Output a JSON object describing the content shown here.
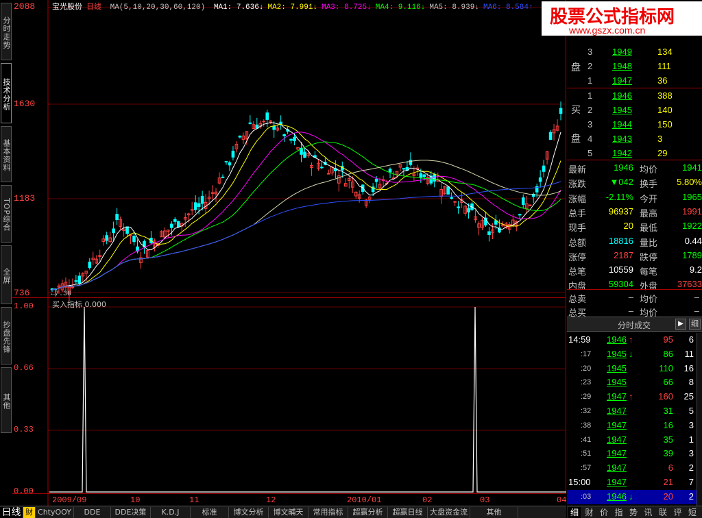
{
  "stock": {
    "name": "宝光股份",
    "period": "日线"
  },
  "ma_header": {
    "ma_params": "MA(5,10,20,30,60,120)",
    "items": [
      {
        "label": "MA1:",
        "value": "7.636↓",
        "color": "#ffffff"
      },
      {
        "label": "MA2:",
        "value": "7.991↓",
        "color": "#ffff00"
      },
      {
        "label": "MA3:",
        "value": "8.725↓",
        "color": "#ff00ff"
      },
      {
        "label": "MA4:",
        "value": "9.116↓",
        "color": "#00ff00"
      },
      {
        "label": "MA5:",
        "value": "8.939↓",
        "color": "#c0c0c0"
      },
      {
        "label": "MA6:",
        "value": "8.584↑",
        "color": "#3050ff"
      }
    ]
  },
  "left_tabs": [
    "分时走势",
    "技术分析",
    "基本资料",
    "TOP综合",
    "全屏",
    "抄盘先锋",
    "其他"
  ],
  "price_axis": [
    "2088",
    "1630",
    "1183",
    "736"
  ],
  "low_marker": "7.36",
  "indicator": {
    "name": "买入指标",
    "value": "0.000",
    "axis": [
      "1.00",
      "0.66",
      "0.33",
      "0.00"
    ]
  },
  "x_axis": [
    "2009/09",
    "10",
    "11",
    "12",
    "2010/01",
    "02",
    "03",
    "04"
  ],
  "bottom_tabs": [
    "日线",
    "财",
    "ChtyOOY",
    "DDE",
    "DDE决策",
    "K.D.J",
    "标准",
    "博文分析",
    "博文晡天",
    "常用指标",
    "超赢分析",
    "超赢日线",
    "大盘资金流",
    "其他"
  ],
  "watermark": {
    "title": "股票公式指标网",
    "url": "www.gszx.com.cn"
  },
  "order_book": {
    "sell": [
      {
        "level": "3",
        "price": "1949",
        "vol": "134"
      },
      {
        "level": "2",
        "price": "1948",
        "vol": "111"
      },
      {
        "level": "1",
        "price": "1947",
        "vol": "36"
      }
    ],
    "buy": [
      {
        "level": "1",
        "price": "1946",
        "vol": "388"
      },
      {
        "level": "2",
        "price": "1945",
        "vol": "140"
      },
      {
        "level": "3",
        "price": "1944",
        "vol": "150"
      },
      {
        "level": "4",
        "price": "1943",
        "vol": "3"
      },
      {
        "level": "5",
        "price": "1942",
        "vol": "29"
      }
    ],
    "sell_label": "盘",
    "buy_label_1": "买",
    "buy_label_2": "盘"
  },
  "quote": [
    {
      "l1": "最新",
      "v1": "1946",
      "c1": "#00ff00",
      "l2": "均价",
      "v2": "1941",
      "c2": "#00ff00"
    },
    {
      "l1": "涨跌",
      "v1": "▼042",
      "c1": "#00ff00",
      "l2": "换手",
      "v2": "5.80%",
      "c2": "#ffff00"
    },
    {
      "l1": "涨幅",
      "v1": "-2.11%",
      "c1": "#00ff00",
      "l2": "今开",
      "v2": "1965",
      "c2": "#00ff00"
    },
    {
      "l1": "总手",
      "v1": "96937",
      "c1": "#ffff00",
      "l2": "最高",
      "v2": "1991",
      "c2": "#ff4040"
    },
    {
      "l1": "现手",
      "v1": "20",
      "c1": "#ffff00",
      "l2": "最低",
      "v2": "1922",
      "c2": "#00ff00"
    },
    {
      "l1": "总额",
      "v1": "18816",
      "c1": "#00ffff",
      "l2": "量比",
      "v2": "0.44",
      "c2": "#ffffff"
    },
    {
      "l1": "涨停",
      "v1": "2187",
      "c1": "#ff4040",
      "l2": "跌停",
      "v2": "1789",
      "c2": "#00ff00"
    },
    {
      "l1": "总笔",
      "v1": "10559",
      "c1": "#ffffff",
      "l2": "每笔",
      "v2": "9.2",
      "c2": "#ffffff"
    },
    {
      "l1": "内盘",
      "v1": "59304",
      "c1": "#00ff00",
      "l2": "外盘",
      "v2": "37633",
      "c2": "#ff4040"
    }
  ],
  "totals": [
    {
      "l1": "总卖",
      "v1": "–",
      "l2": "均价",
      "v2": "–"
    },
    {
      "l1": "总买",
      "v1": "–",
      "l2": "均价",
      "v2": "–"
    }
  ],
  "ticks_title": "分时成交",
  "ticks_btn": "细",
  "ticks": [
    {
      "time": "14:59",
      "price": "1946",
      "arrow": "↑",
      "vol": "95",
      "vc": "#ff4040",
      "n": "6"
    },
    {
      "time": ":17",
      "price": "1945",
      "arrow": "↓",
      "vol": "86",
      "vc": "#00ff00",
      "n": "11"
    },
    {
      "time": ":20",
      "price": "1945",
      "arrow": "",
      "vol": "110",
      "vc": "#00ff00",
      "n": "16"
    },
    {
      "time": ":23",
      "price": "1945",
      "arrow": "",
      "vol": "66",
      "vc": "#00ff00",
      "n": "8"
    },
    {
      "time": ":29",
      "price": "1947",
      "arrow": "↑",
      "vol": "160",
      "vc": "#ff4040",
      "n": "25"
    },
    {
      "time": ":32",
      "price": "1947",
      "arrow": "",
      "vol": "31",
      "vc": "#00ff00",
      "n": "5"
    },
    {
      "time": ":38",
      "price": "1947",
      "arrow": "",
      "vol": "16",
      "vc": "#00ff00",
      "n": "3"
    },
    {
      "time": ":41",
      "price": "1947",
      "arrow": "",
      "vol": "35",
      "vc": "#00ff00",
      "n": "1"
    },
    {
      "time": ":51",
      "price": "1947",
      "arrow": "",
      "vol": "39",
      "vc": "#00ff00",
      "n": "3"
    },
    {
      "time": ":57",
      "price": "1947",
      "arrow": "",
      "vol": "6",
      "vc": "#ff4040",
      "n": "2"
    },
    {
      "time": "15:00",
      "price": "1947",
      "arrow": "",
      "vol": "21",
      "vc": "#ff4040",
      "n": "7"
    },
    {
      "time": ":03",
      "price": "1946",
      "arrow": "↓",
      "vol": "20",
      "vc": "#ff4040",
      "n": "2"
    }
  ],
  "right_bottom_tabs": [
    "细",
    "财",
    "价",
    "指",
    "势",
    "讯",
    "联",
    "评",
    "短"
  ]
}
